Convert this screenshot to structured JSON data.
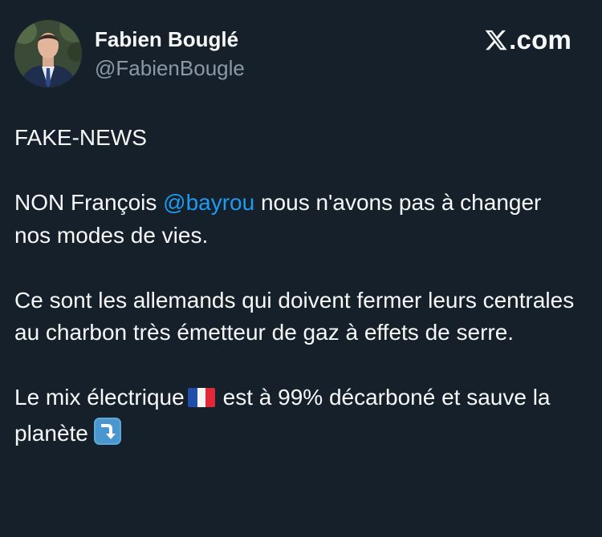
{
  "author": {
    "display_name": "Fabien Bouglé",
    "handle": "@FabienBougle",
    "avatar": "profile-photo"
  },
  "brand": {
    "icon": "x-logo-icon",
    "suffix": ".com"
  },
  "tweet": {
    "line1": "FAKE-NEWS",
    "para2_before_mention": "NON François ",
    "mention": "@bayrou",
    "para2_after_mention": " nous n'avons pas à changer nos modes de vies.",
    "para3": "Ce sont les allemands qui doivent fermer leurs centrales au charbon très émetteur de gaz à effets de serre.",
    "para4_before_flag": "Le mix électrique",
    "flag_icon": "france-flag-icon",
    "para4_after_flag": "est à 99% décarboné et sauve la planète",
    "arrow_icon": "arrow-down-right-emoji-icon"
  },
  "colors": {
    "background": "#15202b",
    "text": "#f7f9f9",
    "secondary_text": "#8b98a5",
    "link": "#1d9bf0"
  }
}
